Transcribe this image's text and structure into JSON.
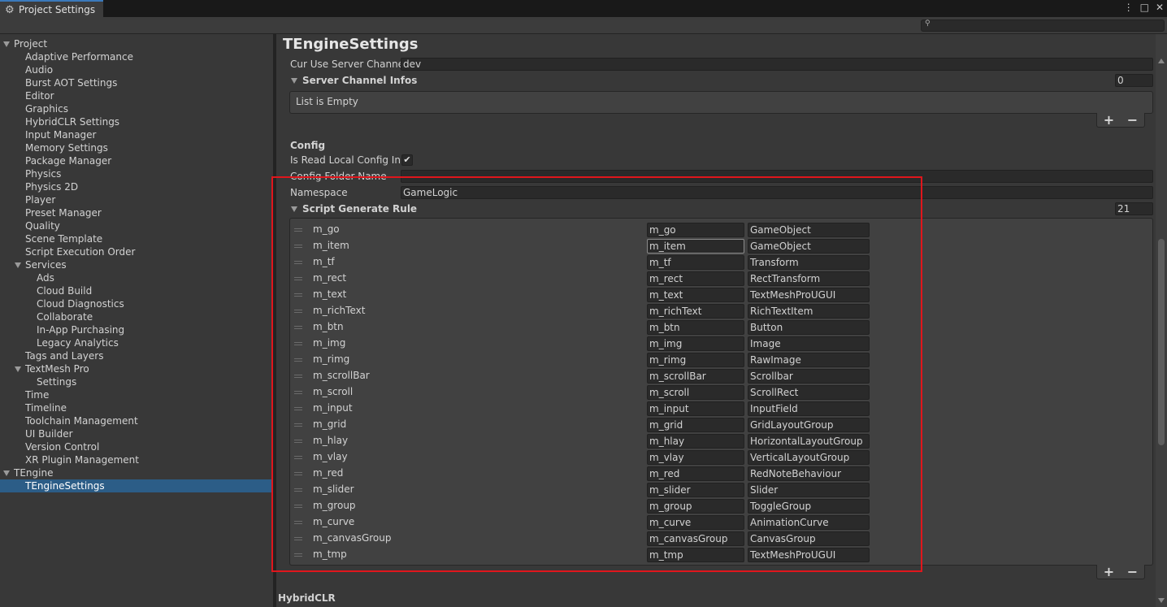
{
  "window": {
    "tab_title": "Project Settings",
    "controls": [
      "⋮",
      "□",
      "✕"
    ]
  },
  "search": {
    "placeholder": "",
    "icon": "search-icon"
  },
  "sidebar": {
    "items": [
      {
        "label": "Project",
        "level": 0,
        "expanded": true
      },
      {
        "label": "Adaptive Performance",
        "level": 1
      },
      {
        "label": "Audio",
        "level": 1
      },
      {
        "label": "Burst AOT Settings",
        "level": 1
      },
      {
        "label": "Editor",
        "level": 1
      },
      {
        "label": "Graphics",
        "level": 1
      },
      {
        "label": "HybridCLR Settings",
        "level": 1
      },
      {
        "label": "Input Manager",
        "level": 1
      },
      {
        "label": "Memory Settings",
        "level": 1
      },
      {
        "label": "Package Manager",
        "level": 1
      },
      {
        "label": "Physics",
        "level": 1
      },
      {
        "label": "Physics 2D",
        "level": 1
      },
      {
        "label": "Player",
        "level": 1
      },
      {
        "label": "Preset Manager",
        "level": 1
      },
      {
        "label": "Quality",
        "level": 1
      },
      {
        "label": "Scene Template",
        "level": 1
      },
      {
        "label": "Script Execution Order",
        "level": 1
      },
      {
        "label": "Services",
        "level": 1,
        "expanded": true
      },
      {
        "label": "Ads",
        "level": 2
      },
      {
        "label": "Cloud Build",
        "level": 2
      },
      {
        "label": "Cloud Diagnostics",
        "level": 2
      },
      {
        "label": "Collaborate",
        "level": 2
      },
      {
        "label": "In-App Purchasing",
        "level": 2
      },
      {
        "label": "Legacy Analytics",
        "level": 2
      },
      {
        "label": "Tags and Layers",
        "level": 1
      },
      {
        "label": "TextMesh Pro",
        "level": 1,
        "expanded": true
      },
      {
        "label": "Settings",
        "level": 2
      },
      {
        "label": "Time",
        "level": 1
      },
      {
        "label": "Timeline",
        "level": 1
      },
      {
        "label": "Toolchain Management",
        "level": 1
      },
      {
        "label": "UI Builder",
        "level": 1
      },
      {
        "label": "Version Control",
        "level": 1
      },
      {
        "label": "XR Plugin Management",
        "level": 1
      },
      {
        "label": "TEngine",
        "level": 0,
        "expanded": true
      },
      {
        "label": "TEngineSettings",
        "level": 1,
        "selected": true
      }
    ]
  },
  "main": {
    "title": "TEngineSettings",
    "cur_use_server_channel": {
      "label": "Cur Use Server Channel",
      "value": "dev"
    },
    "server_channel_infos": {
      "label": "Server Channel Infos",
      "count": "0",
      "empty_text": "List is Empty"
    },
    "config": {
      "header": "Config",
      "is_read_local": {
        "label": "Is Read Local Config In E",
        "checked": true,
        "check_glyph": "✔"
      },
      "config_folder_name": {
        "label": "Config Folder Name",
        "value": ""
      },
      "namespace": {
        "label": "Namespace",
        "value": "GameLogic"
      }
    },
    "script_generate_rule": {
      "label": "Script Generate Rule",
      "count": "21",
      "rows": [
        {
          "name": "m_go",
          "prefix": "m_go",
          "type": "GameObject"
        },
        {
          "name": "m_item",
          "prefix": "m_item",
          "type": "GameObject",
          "focused": true
        },
        {
          "name": "m_tf",
          "prefix": "m_tf",
          "type": "Transform"
        },
        {
          "name": "m_rect",
          "prefix": "m_rect",
          "type": "RectTransform"
        },
        {
          "name": "m_text",
          "prefix": "m_text",
          "type": "TextMeshProUGUI"
        },
        {
          "name": "m_richText",
          "prefix": "m_richText",
          "type": "RichTextItem"
        },
        {
          "name": "m_btn",
          "prefix": "m_btn",
          "type": "Button"
        },
        {
          "name": "m_img",
          "prefix": "m_img",
          "type": "Image"
        },
        {
          "name": "m_rimg",
          "prefix": "m_rimg",
          "type": "RawImage"
        },
        {
          "name": "m_scrollBar",
          "prefix": "m_scrollBar",
          "type": "Scrollbar"
        },
        {
          "name": "m_scroll",
          "prefix": "m_scroll",
          "type": "ScrollRect"
        },
        {
          "name": "m_input",
          "prefix": "m_input",
          "type": "InputField"
        },
        {
          "name": "m_grid",
          "prefix": "m_grid",
          "type": "GridLayoutGroup"
        },
        {
          "name": "m_hlay",
          "prefix": "m_hlay",
          "type": "HorizontalLayoutGroup"
        },
        {
          "name": "m_vlay",
          "prefix": "m_vlay",
          "type": "VerticalLayoutGroup"
        },
        {
          "name": "m_red",
          "prefix": "m_red",
          "type": "RedNoteBehaviour"
        },
        {
          "name": "m_slider",
          "prefix": "m_slider",
          "type": "Slider"
        },
        {
          "name": "m_group",
          "prefix": "m_group",
          "type": "ToggleGroup"
        },
        {
          "name": "m_curve",
          "prefix": "m_curve",
          "type": "AnimationCurve"
        },
        {
          "name": "m_canvasGroup",
          "prefix": "m_canvasGroup",
          "type": "CanvasGroup"
        },
        {
          "name": "m_tmp",
          "prefix": "m_tmp",
          "type": "TextMeshProUGUI"
        }
      ]
    },
    "add_label": "+",
    "remove_label": "−",
    "hybridclr_header": "HybridCLR"
  },
  "colors": {
    "highlight_box": "#e0161c",
    "selection": "#2c5d87",
    "tab_accent": "#3a79bb"
  }
}
